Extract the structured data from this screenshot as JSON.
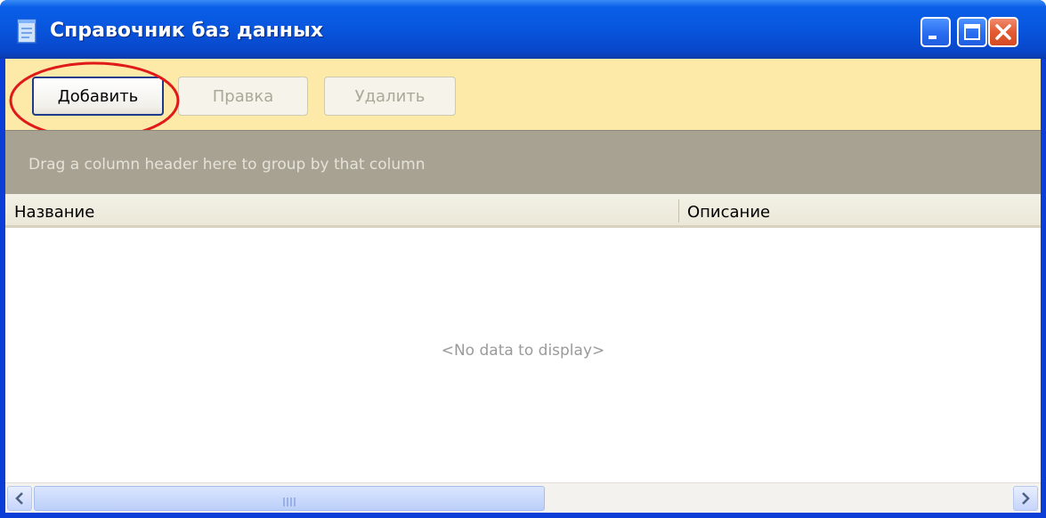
{
  "window": {
    "title": "Справочник баз данных",
    "icon": "document-icon",
    "controls": {
      "minimize": "minimize-icon",
      "maximize": "maximize-icon",
      "close": "close-icon"
    }
  },
  "toolbar": {
    "add_label": "Добавить",
    "edit_label": "Правка",
    "delete_label": "Удалить"
  },
  "group_panel": {
    "hint": "Drag a column header here to group by that column"
  },
  "grid": {
    "columns": [
      {
        "label": "Название"
      },
      {
        "label": "Описание"
      }
    ],
    "empty_text": "<No data to display>"
  },
  "colors": {
    "titlebar": "#0855dd",
    "toolbar_bg": "#fdeaa8",
    "group_panel_bg": "#a7a292",
    "highlight": "#e01a1a"
  }
}
